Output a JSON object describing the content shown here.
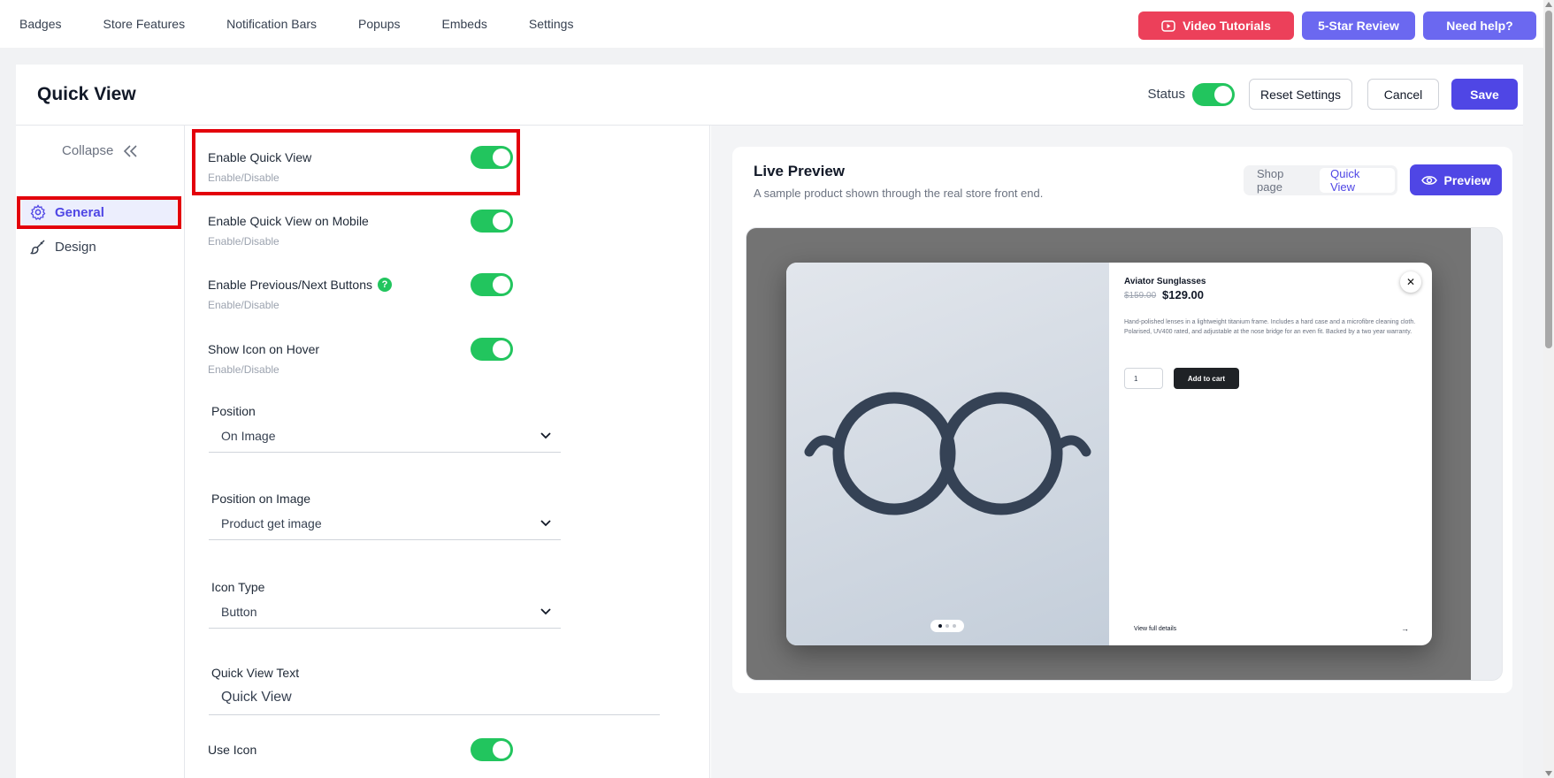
{
  "nav": {
    "links": [
      "Badges",
      "Store Features",
      "Notification Bars",
      "Popups",
      "Embeds",
      "Settings"
    ],
    "video_tutorials": "Video Tutorials",
    "review": "5-Star Review",
    "help": "Need help?"
  },
  "header": {
    "title": "Quick View",
    "status_label": "Status",
    "status_on": true,
    "reset": "Reset Settings",
    "cancel": "Cancel",
    "save": "Save"
  },
  "sidebar": {
    "collapse": "Collapse",
    "items": [
      {
        "label": "General",
        "icon": "gear-icon",
        "active": true
      },
      {
        "label": "Design",
        "icon": "brush-icon",
        "active": false
      }
    ]
  },
  "settings": {
    "toggles": [
      {
        "label": "Enable Quick View",
        "sub": "Enable/Disable",
        "on": true
      },
      {
        "label": "Enable Quick View on Mobile",
        "sub": "Enable/Disable",
        "on": true
      },
      {
        "label": "Enable Previous/Next Buttons",
        "sub": "Enable/Disable",
        "on": true,
        "help": "?"
      },
      {
        "label": "Show Icon on Hover",
        "sub": "Enable/Disable",
        "on": true
      }
    ],
    "position": {
      "label": "Position",
      "value": "On Image"
    },
    "position_on_image": {
      "label": "Position on Image",
      "value": "Product get image"
    },
    "icon_type": {
      "label": "Icon Type",
      "value": "Button"
    },
    "quick_view_text": {
      "label": "Quick View Text",
      "value": "Quick View"
    },
    "use_icon": {
      "label": "Use Icon",
      "on": true
    }
  },
  "preview": {
    "title": "Live Preview",
    "subtitle": "A sample product shown through the real store front end.",
    "tabs": [
      "Shop page",
      "Quick View"
    ],
    "active_tab": "Quick View",
    "preview_button": "Preview",
    "product": {
      "name": "Aviator Sunglasses",
      "old_price": "$159.00",
      "price": "$129.00",
      "desc_1": "Hand-polished lenses in a lightweight titanium frame. Includes a hard case and a microfibre cleaning cloth.",
      "desc_2": "Polarised, UV400 rated, and adjustable at the nose bridge for an even fit. Backed by a two year warranty.",
      "qty": "1",
      "add_to_cart": "Add to cart",
      "close": "✕",
      "view_details": "View full details",
      "arrow": "→"
    }
  },
  "colors": {
    "accent": "#4f46e5",
    "toggle_on": "#22c55e",
    "highlight": "#e3000b",
    "video_red": "#ec405a"
  }
}
